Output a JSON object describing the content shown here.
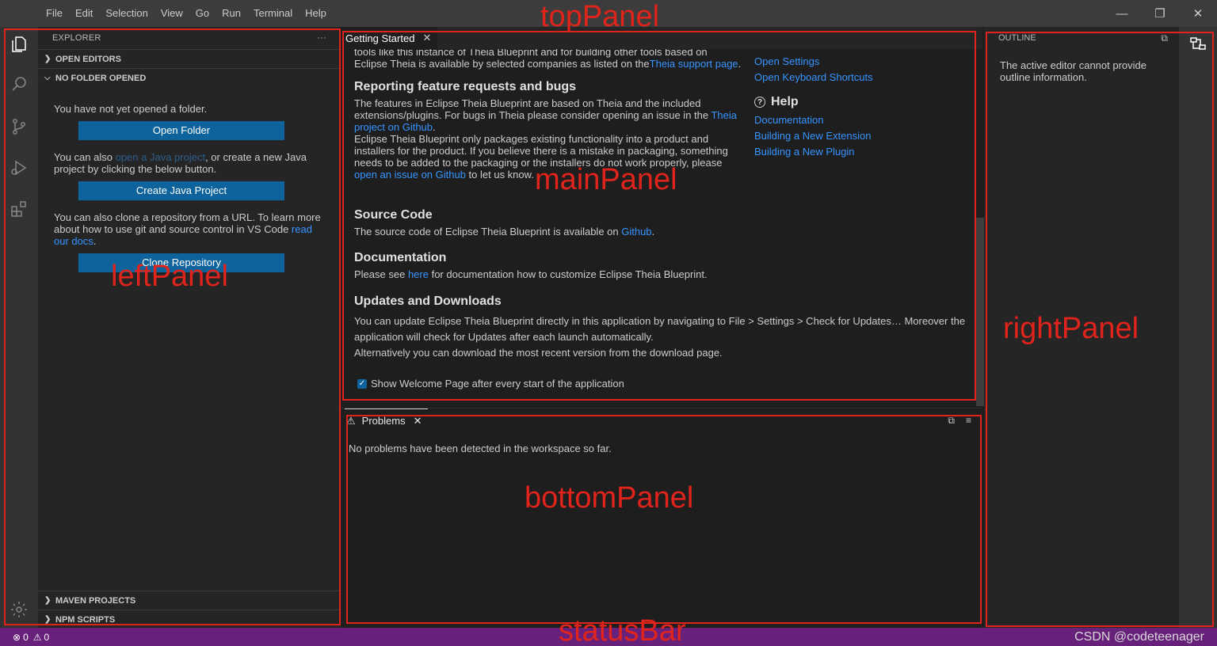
{
  "menu": [
    "File",
    "Edit",
    "Selection",
    "View",
    "Go",
    "Run",
    "Terminal",
    "Help"
  ],
  "window_controls": {
    "minimize": "—",
    "restore": "❐",
    "close": "✕"
  },
  "explorer": {
    "title": "EXPLORER",
    "more": "···",
    "open_editors": "OPEN EDITORS",
    "no_folder": "NO FOLDER OPENED",
    "msg_not_opened": "You have not yet opened a folder.",
    "btn_open_folder": "Open Folder",
    "msg_also_1": "You can also ",
    "link_open_java": "open a Java project",
    "msg_also_2": ", or create a new Java project by clicking the below button.",
    "btn_create_java": "Create Java Project",
    "msg_clone_1": "You can also clone a repository from a URL. To learn more about how to use git and source control in VS Code ",
    "link_read_docs": "read our docs",
    "msg_clone_2": ".",
    "btn_clone": "Clone Repository",
    "maven": "MAVEN PROJECTS",
    "npm": "NPM SCRIPTS"
  },
  "editor": {
    "tab_label": "Getting Started",
    "intro_cut": "tools like this instance of Theia Blueprint and for building other tools based on",
    "intro_2": "Eclipse Theia is available by selected companies as listed on the",
    "link_theia_support": "Theia support page",
    "intro_end": ".",
    "feature_title": "Reporting feature requests and bugs",
    "feature_1": "The features in Eclipse Theia Blueprint are based on Theia and the included extensions/plugins. For bugs in Theia please consider opening an issue in the ",
    "link_theia_github": "Theia project on Github",
    "feature_2": ".",
    "feature_3": "Eclipse Theia Blueprint only packages existing functionality into a product and installers for the product. If you believe there is a mistake in packaging, something needs to be added to the packaging or the installers do not work properly, please ",
    "link_open_issue": "open an issue on Github",
    "feature_4": " to let us know.",
    "source_title": "Source Code",
    "source_1": "The source code of Eclipse Theia Blueprint is available on ",
    "link_github": "Github",
    "source_2": ".",
    "docs_title": "Documentation",
    "docs_1": "Please see ",
    "link_here": "here",
    "docs_2": " for documentation how to customize Eclipse Theia Blueprint.",
    "updates_title": "Updates and Downloads",
    "updates_1": "You can update Eclipse Theia Blueprint directly in this application by navigating to File > Settings > Check for Updates… Moreover the application will check for Updates after each launch automatically.",
    "updates_2": "Alternatively you can download the most recent version from the download page.",
    "checkbox_label": "Show Welcome Page after every start of the application",
    "right_links": [
      "Open Settings",
      "Open Keyboard Shortcuts"
    ],
    "help_title": "Help",
    "help_links": [
      "Documentation",
      "Building a New Extension",
      "Building a New Plugin"
    ]
  },
  "problems": {
    "tab_label": "Problems",
    "message": "No problems have been detected in the workspace so far."
  },
  "outline": {
    "title": "OUTLINE",
    "message": "The active editor cannot provide outline information."
  },
  "status": {
    "errors": "0",
    "warnings": "0",
    "watermark": "CSDN @codeteenager"
  },
  "annotations": {
    "top": "topPanel",
    "left": "leftPanel",
    "main": "mainPanel",
    "right": "rightPanel",
    "bottom": "bottomPanel",
    "status": "statusBar"
  },
  "colors": {
    "annotation": "#e0241b",
    "statusbar": "#68217a",
    "button": "#0e639c",
    "link": "#3794ff"
  }
}
